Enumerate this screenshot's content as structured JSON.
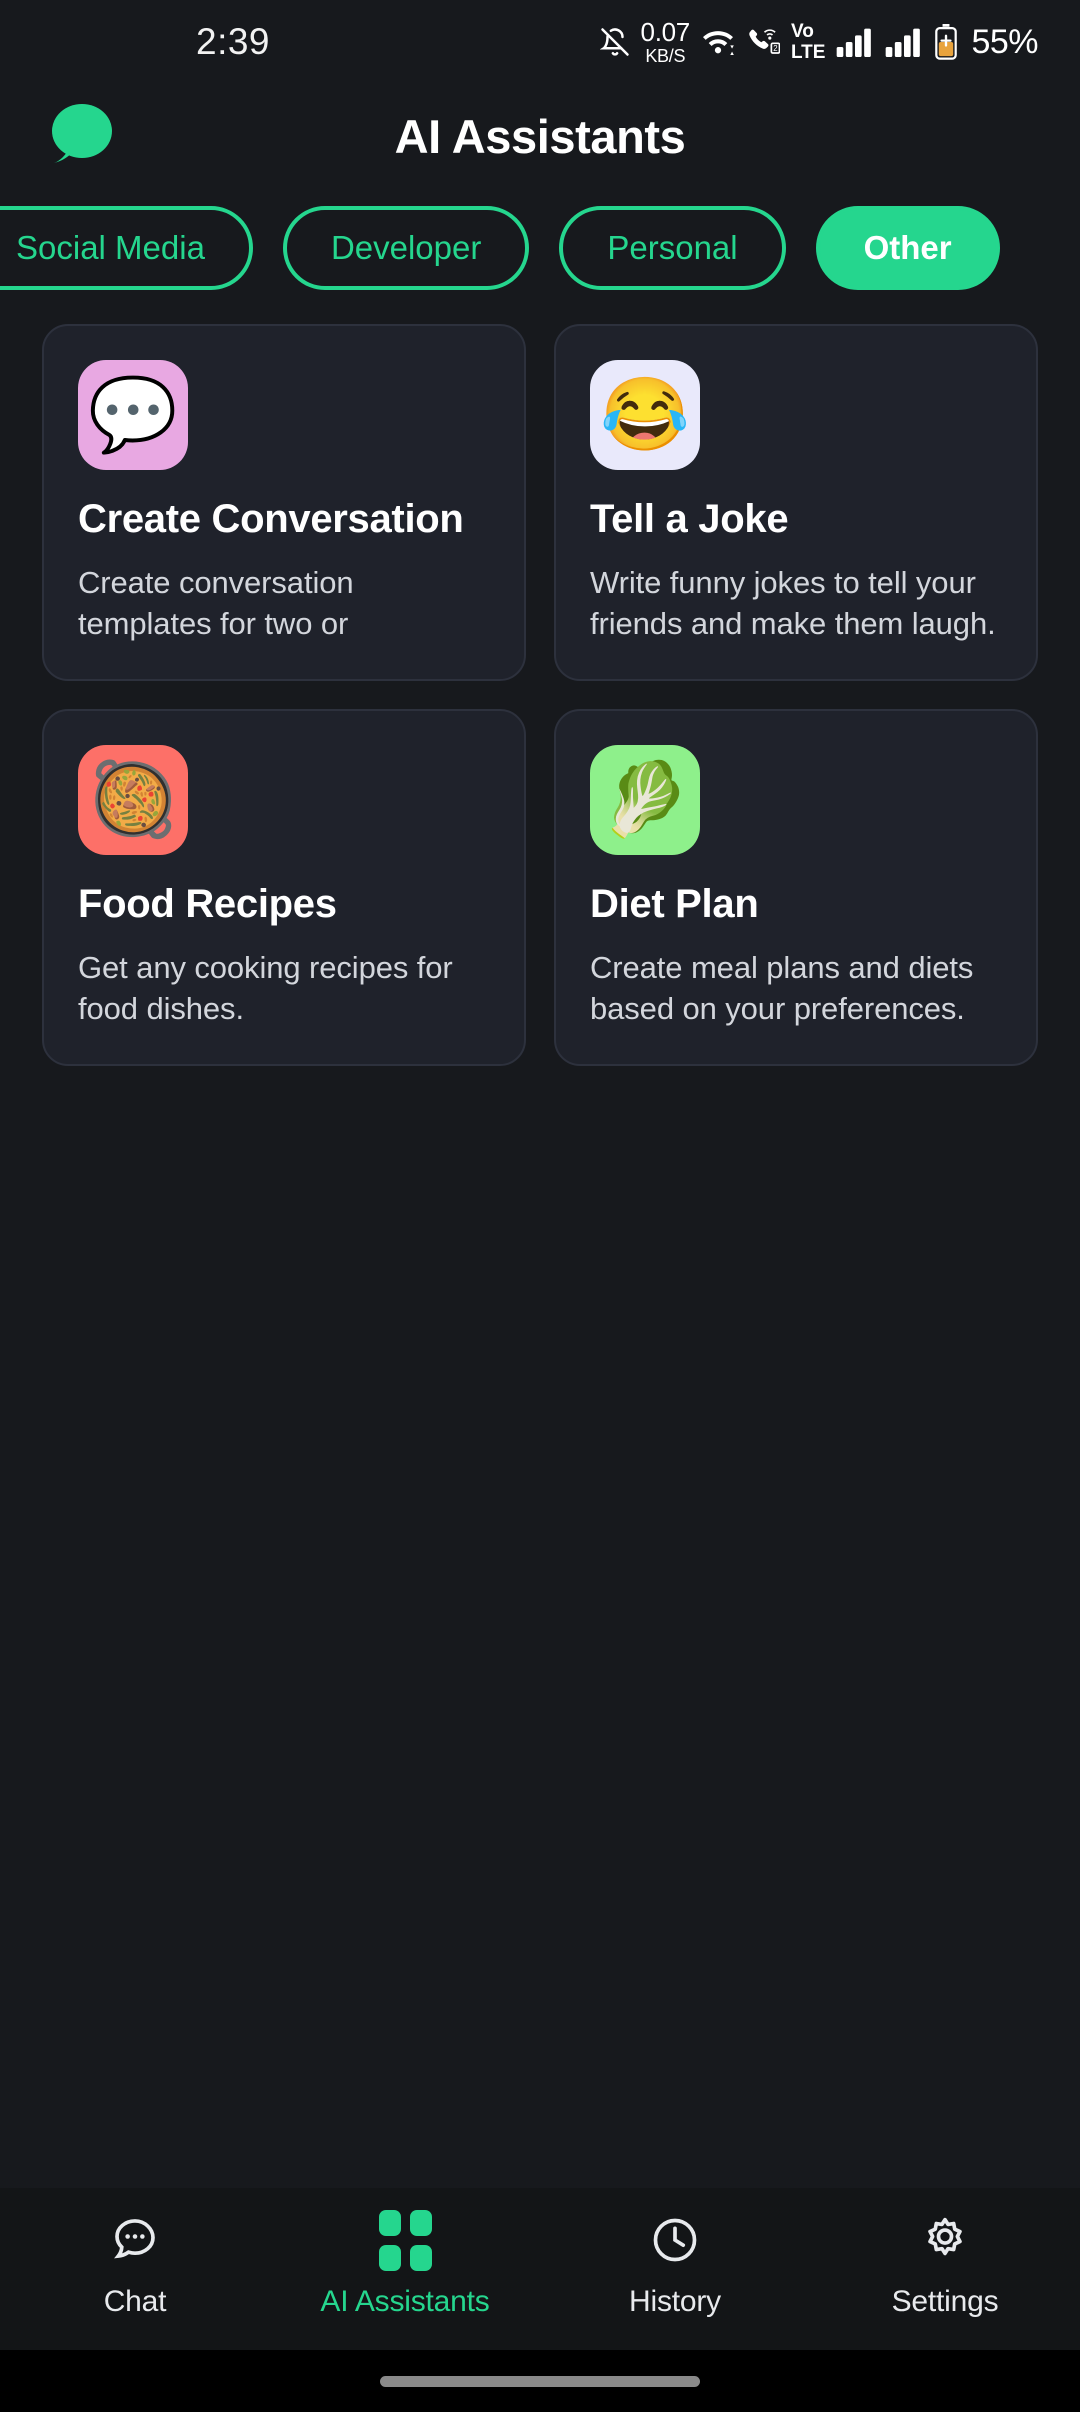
{
  "status_bar": {
    "time": "2:39",
    "mute_icon": "bell-slash-icon",
    "net_speed_value": "0.07",
    "net_speed_unit": "KB/S",
    "wifi_icon": "wifi-icon",
    "call_wifi_icon": "call-over-wifi-icon",
    "sim_badge": "2",
    "volte_line1": "Vo",
    "volte_line2": "LTE",
    "signal_icon_1": "signal-bars-icon",
    "signal_icon_2": "signal-bars-icon",
    "battery_icon": "battery-charging-icon",
    "battery_percent": "55%"
  },
  "header": {
    "logo_icon": "chat-bubble-logo-icon",
    "title": "AI Assistants"
  },
  "categories": {
    "items": [
      {
        "label": "Social Media",
        "selected": false
      },
      {
        "label": "Developer",
        "selected": false
      },
      {
        "label": "Personal",
        "selected": false
      },
      {
        "label": "Other",
        "selected": true
      }
    ]
  },
  "assistants": [
    {
      "title": "Create Conversation",
      "description": "Create conversation templates for two or",
      "emoji": "💬",
      "icon_name": "speech-balloon-emoji",
      "icon_bg": "#e8a8e2"
    },
    {
      "title": "Tell a Joke",
      "description": "Write funny jokes to tell your friends and make them laugh.",
      "emoji": "😂",
      "icon_name": "face-with-tears-of-joy-emoji",
      "icon_bg": "#e9e9fb"
    },
    {
      "title": "Food Recipes",
      "description": "Get any cooking recipes for food dishes.",
      "emoji": "🥘",
      "icon_name": "shallow-pan-of-food-emoji",
      "icon_bg": "#fd7068"
    },
    {
      "title": "Diet Plan",
      "description": "Create meal plans and diets based on your preferences.",
      "emoji": "🥬",
      "icon_name": "leafy-green-emoji",
      "icon_bg": "#8ef08b"
    }
  ],
  "bottom_nav": {
    "items": [
      {
        "label": "Chat",
        "icon": "chat-bubble-dots-icon",
        "active": false
      },
      {
        "label": "AI Assistants",
        "icon": "grid-squares-icon",
        "active": true
      },
      {
        "label": "History",
        "icon": "clock-icon",
        "active": false
      },
      {
        "label": "Settings",
        "icon": "gear-icon",
        "active": false
      }
    ]
  },
  "colors": {
    "accent_green": "#25d68e",
    "page_bg": "#17191d",
    "card_bg": "#1f222b",
    "card_border": "#2d313d",
    "nav_bg": "#131517"
  }
}
